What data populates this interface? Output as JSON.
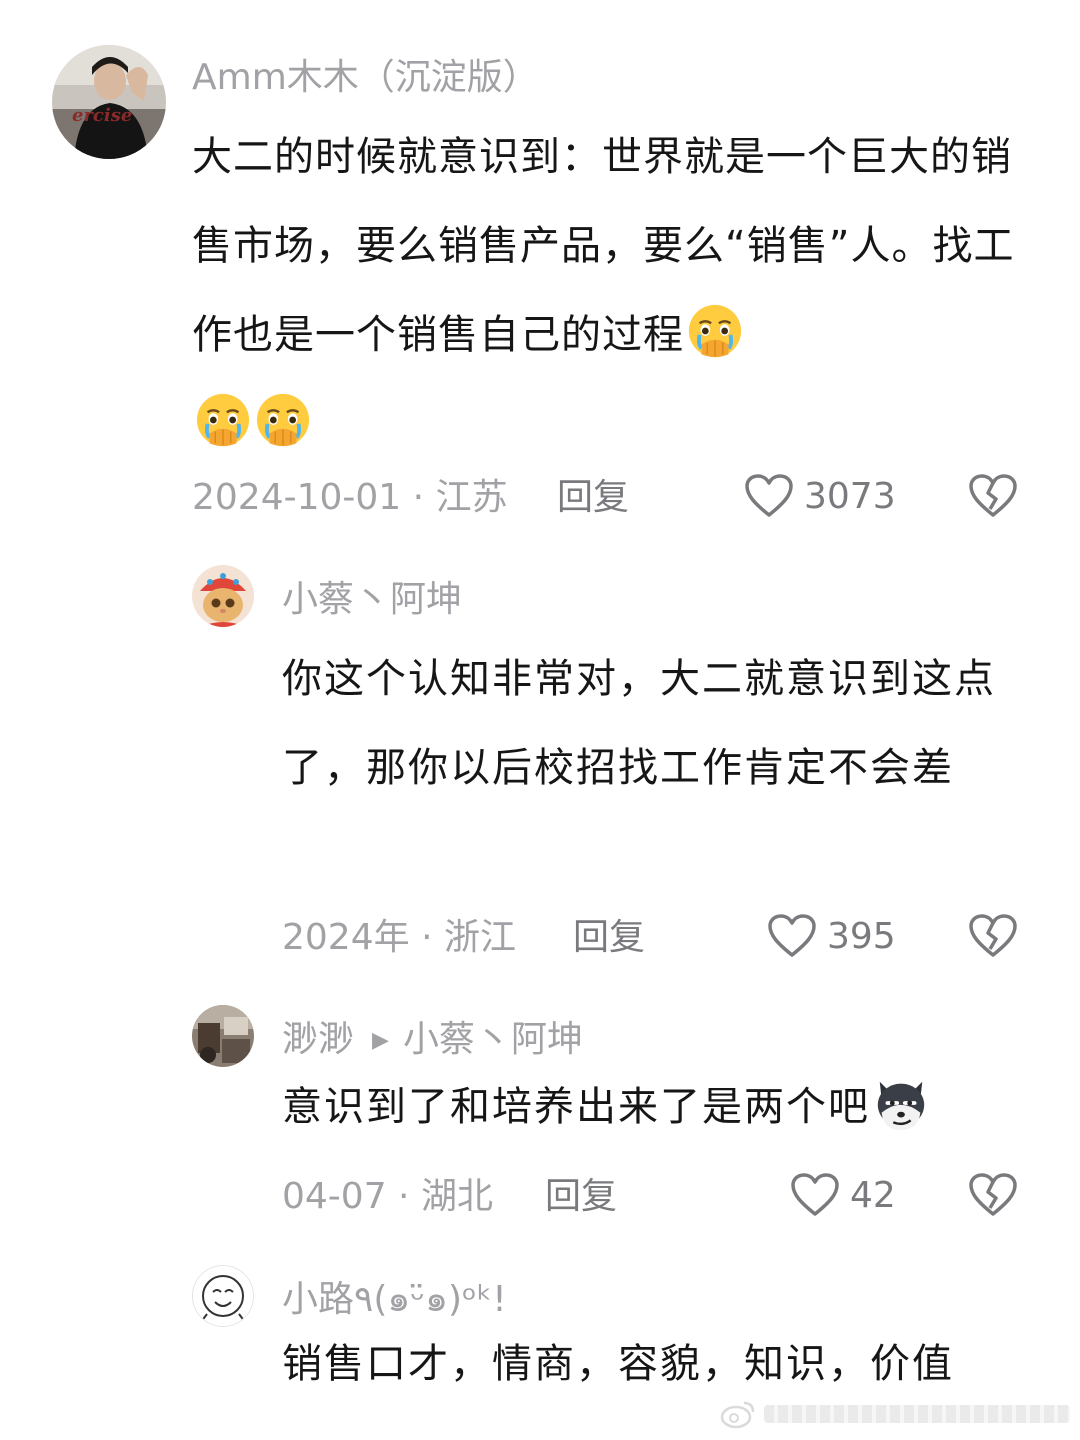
{
  "colors": {
    "username": "#a2a2a6",
    "body_text": "#161616",
    "meta_text": "#a2a2a6",
    "action_text": "#7a7a7e",
    "background": "#ffffff"
  },
  "comments": [
    {
      "username": "Amm木木（沉淀版）",
      "avatar_icon": "avatar-photo-person",
      "text": "大二的时候就意识到：世界就是一个巨大的销售市场，要么销售产品，要么“销售”人。找工作也是一个销售自己的过程",
      "emojis": [
        "crying-hand-over-mouth-emoji",
        "crying-hand-over-mouth-emoji",
        "crying-hand-over-mouth-emoji"
      ],
      "date": "2024-10-01",
      "location": "江苏",
      "reply_label": "回复",
      "likes": "3073",
      "like_icon": "heart-outline-icon",
      "dislike_icon": "broken-heart-icon"
    },
    {
      "username": "小蔡丶阿坤",
      "avatar_icon": "avatar-cat-with-crown",
      "text": "你这个认知非常对，大二就意识到这点了，那你以后校招找工作肯定不会差",
      "date": "2024年",
      "location": "浙江",
      "reply_label": "回复",
      "likes": "395",
      "like_icon": "heart-outline-icon",
      "dislike_icon": "broken-heart-icon"
    },
    {
      "username": "渺渺",
      "reply_to": "小蔡丶阿坤",
      "reply_arrow_icon": "play-triangle-icon",
      "avatar_icon": "avatar-photo-scene",
      "text": "意识到了和培养出来了是两个吧",
      "emojis": [
        "smirking-dog-emoji"
      ],
      "date": "04-07",
      "location": "湖北",
      "reply_label": "回复",
      "likes": "42",
      "like_icon": "heart-outline-icon",
      "dislike_icon": "broken-heart-icon"
    },
    {
      "username": "小路٩(๑ᵕ̈๑)ᵒᵏ!",
      "avatar_icon": "avatar-smiley-sketch",
      "text": "销售口才，情商，容貌，知识，价值"
    }
  ]
}
